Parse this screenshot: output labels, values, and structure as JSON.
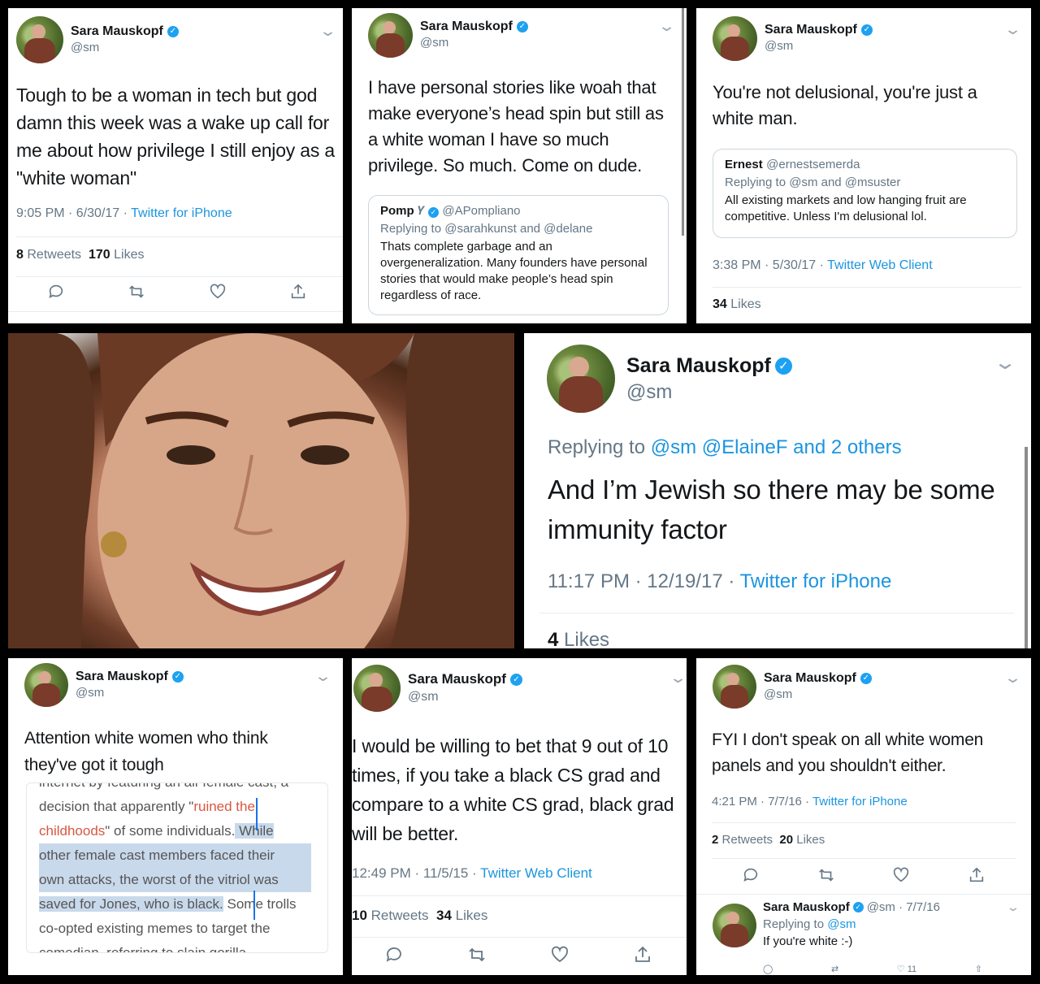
{
  "tweet1": {
    "name": "Sara Mauskopf",
    "handle": "@sm",
    "text": "Tough to be a woman in tech but god damn this week was a wake up call for me about how privilege I still enjoy as a \"white woman\"",
    "time": "9:05 PM · 6/30/17 · ",
    "source": "Twitter for iPhone",
    "retweets": "8",
    "retweets_label": "Retweets",
    "likes": "170",
    "likes_label": "Likes"
  },
  "tweet2": {
    "name": "Sara Mauskopf",
    "handle": "@sm",
    "text": "I have personal stories like woah that make everyone’s head spin but still as a white woman I have so much privilege. So much. Come on dude.",
    "quote": {
      "name": "Pomp",
      "handle": "@APompliano",
      "replying": "Replying to @sarahkunst and @delane",
      "body": "Thats complete garbage and an overgeneralization. Many founders have personal stories that would make people’s head spin regardless of race."
    }
  },
  "tweet3": {
    "name": "Sara Mauskopf",
    "handle": "@sm",
    "text": "You're not delusional, you're just a white man.",
    "quote": {
      "name": "Ernest",
      "handle": "@ernestsemerda",
      "replying": "Replying to @sm and @msuster",
      "body": "All existing markets and low hanging fruit are competitive. Unless I'm delusional lol."
    },
    "time": "3:38 PM · 5/30/17 · ",
    "source": "Twitter Web Client",
    "likes": "34",
    "likes_label": "Likes"
  },
  "tweet4": {
    "name": "Sara Mauskopf",
    "handle": "@sm",
    "replying_prefix": "Replying to ",
    "replying_users": "@sm @ElaineF and 2 others",
    "text": "And I’m Jewish so there may be some immunity factor",
    "time": "11:17 PM · 12/19/17 · ",
    "source": "Twitter for iPhone",
    "likes": "4",
    "likes_label": "Likes"
  },
  "tweet5": {
    "name": "Sara Mauskopf",
    "handle": "@sm",
    "text": "Attention white women who think they've got it tough",
    "article": {
      "line0": "internet by featuring an all-female cast, a",
      "line1_a": "decision that apparently \"",
      "line1_b": "ruined the",
      "line2_a": "childhoods",
      "line2_b": "\" of some individuals.",
      "line2_c": " While",
      "line3": "other female cast members faced their",
      "line4": "own attacks, the worst of the vitriol was",
      "line5_a": "saved for Jones, who is black.",
      "line5_b": " Some trolls",
      "line6": "co-opted existing memes to target the",
      "line7": "comedian, referring to slain gorilla"
    }
  },
  "tweet6": {
    "name": "Sara Mauskopf",
    "handle": "@sm",
    "text": "I would be willing to bet that 9 out of 10 times, if you take a black CS grad and compare to a white CS grad, black grad will be better.",
    "time": "12:49 PM · 11/5/15 · ",
    "source": "Twitter Web Client",
    "retweets": "10",
    "retweets_label": "Retweets",
    "likes": "34",
    "likes_label": "Likes"
  },
  "tweet7": {
    "name": "Sara Mauskopf",
    "handle": "@sm",
    "text": "FYI I don't speak on all white women panels and you shouldn't either.",
    "time": "4:21 PM · 7/7/16 · ",
    "source": "Twitter for iPhone",
    "retweets": "2",
    "retweets_label": "Retweets",
    "likes": "20",
    "likes_label": "Likes",
    "reply": {
      "name": "Sara Mauskopf",
      "handle_time": "@sm · 7/7/16",
      "replying_prefix": "Replying to ",
      "replying_user": "@sm",
      "text": "If you're white :-)",
      "like_count": "11"
    }
  },
  "colors": {
    "link": "#1b95e0",
    "verified": "#1da1f2",
    "muted": "#657786",
    "highlight": "#c9d9ec",
    "article_link": "#d9573f"
  }
}
